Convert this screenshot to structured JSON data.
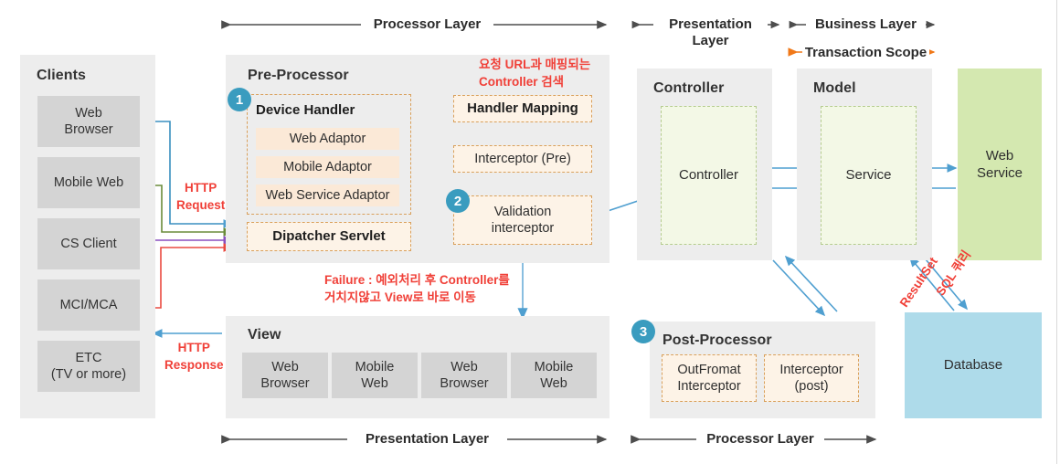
{
  "title": "Spring MVC Request Processing Architecture",
  "layers": {
    "top_processor": "Processor Layer",
    "top_presentation": "Presentation\nLayer",
    "top_business": "Business Layer",
    "transaction_scope": "Transaction Scope",
    "bottom_presentation": "Presentation Layer",
    "bottom_processor": "Processor Layer"
  },
  "clients": {
    "title": "Clients",
    "items": [
      "Web\nBrowser",
      "Mobile Web",
      "CS Client",
      "MCI/MCA",
      "ETC\n(TV or more)"
    ]
  },
  "preprocessor": {
    "title": "Pre-Processor",
    "badge": "1",
    "device_handler": "Device Handler",
    "adaptors": [
      "Web Adaptor",
      "Mobile Adaptor",
      "Web Service Adaptor"
    ],
    "dispatcher": "Dipatcher Servlet",
    "handler_mapping": "Handler Mapping",
    "interceptor_pre": "Interceptor (Pre)",
    "validation_badge": "2",
    "validation": "Validation\ninterceptor"
  },
  "annotations": {
    "url_mapping": "요청 URL과 매핑되는\nController 검색",
    "failure": "Failure : 예외처리 후 Controller를\n거치지않고 View로 바로 이동",
    "http_request": "HTTP\nRequest",
    "http_response": "HTTP\nResponse",
    "sql_query": "SQL 쿼리",
    "resultset": "ResultSet"
  },
  "view": {
    "title": "View",
    "items": [
      "Web\nBrowser",
      "Mobile\nWeb",
      "Web\nBrowser",
      "Mobile\nWeb"
    ]
  },
  "controller_panel": {
    "title": "Controller",
    "inner": "Controller"
  },
  "model_panel": {
    "title": "Model",
    "inner": "Service"
  },
  "webservice": {
    "label": "Web\nService"
  },
  "database": {
    "label": "Database"
  },
  "postprocessor": {
    "badge": "3",
    "title": "Post-Processor",
    "items": [
      "OutFromat\nInterceptor",
      "Interceptor\n(post)"
    ]
  },
  "colors": {
    "panel_bg": "#ededed",
    "chip_bg": "#d4d4d4",
    "dashed_orange": "#d9a05b",
    "dashed_orange_fill": "#fdf3e7",
    "dashed_green": "#b5cc8e",
    "dashed_green_fill": "#f3f8e6",
    "badge": "#3a9cbf",
    "webservice_bg": "#d4e8b0",
    "database_bg": "#aedbea",
    "arrow_blue": "#4f9fd0",
    "arrow_green": "#6a8c3a",
    "arrow_purple": "#8a4fbf",
    "arrow_red": "#ea4a40",
    "red_text": "#f04038",
    "orange_text": "#f07818",
    "layer_arrow": "#4d4d4d"
  }
}
